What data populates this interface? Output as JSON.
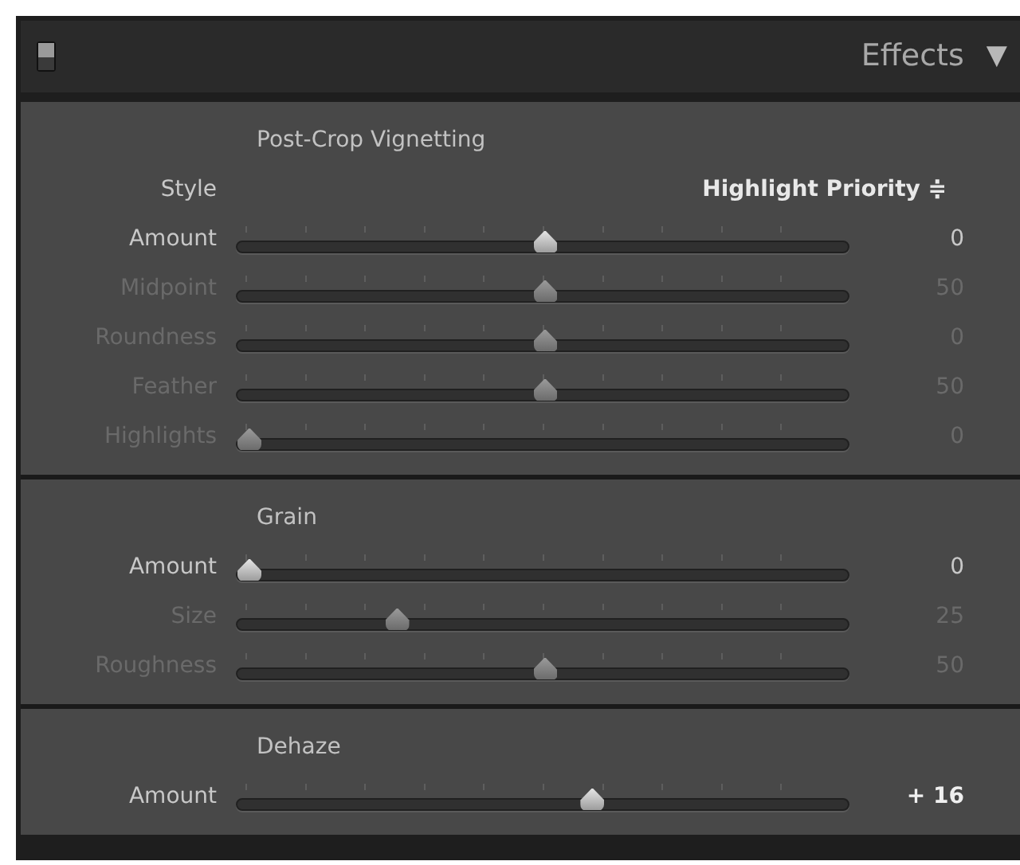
{
  "panel": {
    "title": "Effects",
    "collapse_glyph": "▼",
    "enabled": true
  },
  "sections": [
    {
      "title": "Post-Crop Vignetting",
      "style": {
        "label": "Style",
        "value": "Highlight Priority",
        "glyph": "≑"
      },
      "sliders": [
        {
          "label": "Amount",
          "value": "0",
          "level": 0.5,
          "disabled": false
        },
        {
          "label": "Midpoint",
          "value": "50",
          "level": 0.5,
          "disabled": true
        },
        {
          "label": "Roundness",
          "value": "0",
          "level": 0.5,
          "disabled": true
        },
        {
          "label": "Feather",
          "value": "50",
          "level": 0.5,
          "disabled": true
        },
        {
          "label": "Highlights",
          "value": "0",
          "level": 0,
          "disabled": true
        }
      ]
    },
    {
      "title": "Grain",
      "sliders": [
        {
          "label": "Amount",
          "value": "0",
          "level": 0,
          "disabled": false
        },
        {
          "label": "Size",
          "value": "25",
          "level": 0.25,
          "disabled": true
        },
        {
          "label": "Roughness",
          "value": "50",
          "level": 0.5,
          "disabled": true
        }
      ]
    },
    {
      "title": "Dehaze",
      "sliders": [
        {
          "label": "Amount",
          "value": "+ 16",
          "level": 0.58,
          "disabled": false
        }
      ]
    }
  ]
}
